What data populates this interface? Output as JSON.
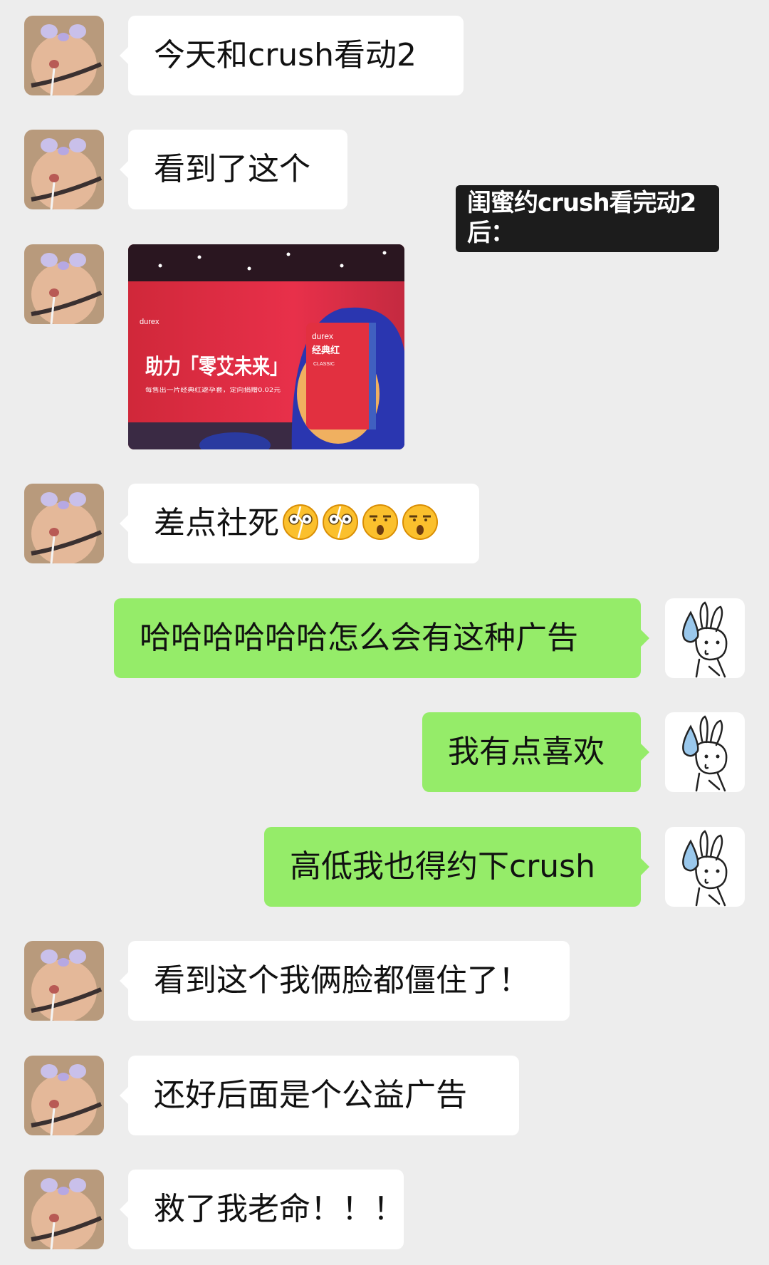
{
  "overlay_caption": "闺蜜约crush看完动2后：",
  "messages": [
    {
      "side": "in",
      "text": "今天和crush看动2"
    },
    {
      "side": "in",
      "text": "看到了这个"
    },
    {
      "side": "in",
      "type": "image",
      "image": {
        "brand_small": "durex",
        "slogan": "助力「零艾未来」",
        "subtext": "每售出一片经典红避孕套，定向捐赠0.02元",
        "box_brand": "durex",
        "box_name": "经典红",
        "box_sub": "CLASSIC"
      }
    },
    {
      "side": "in",
      "text": "差点社死",
      "emojis": [
        "shocked-emoji",
        "shocked-emoji",
        "speechless-emoji",
        "speechless-emoji"
      ]
    },
    {
      "side": "out",
      "text": "哈哈哈哈哈哈怎么会有这种广告"
    },
    {
      "side": "out",
      "text": "我有点喜欢"
    },
    {
      "side": "out",
      "text": "高低我也得约下crush"
    },
    {
      "side": "in",
      "text": "看到这个我俩脸都僵住了！"
    },
    {
      "side": "in",
      "text": "还好后面是个公益广告"
    },
    {
      "side": "in",
      "text": "救了我老命！！！"
    }
  ],
  "colors": {
    "background": "#ededed",
    "incoming": "#ffffff",
    "outgoing": "#95ec69",
    "caption_bg": "#1c1c1c"
  }
}
